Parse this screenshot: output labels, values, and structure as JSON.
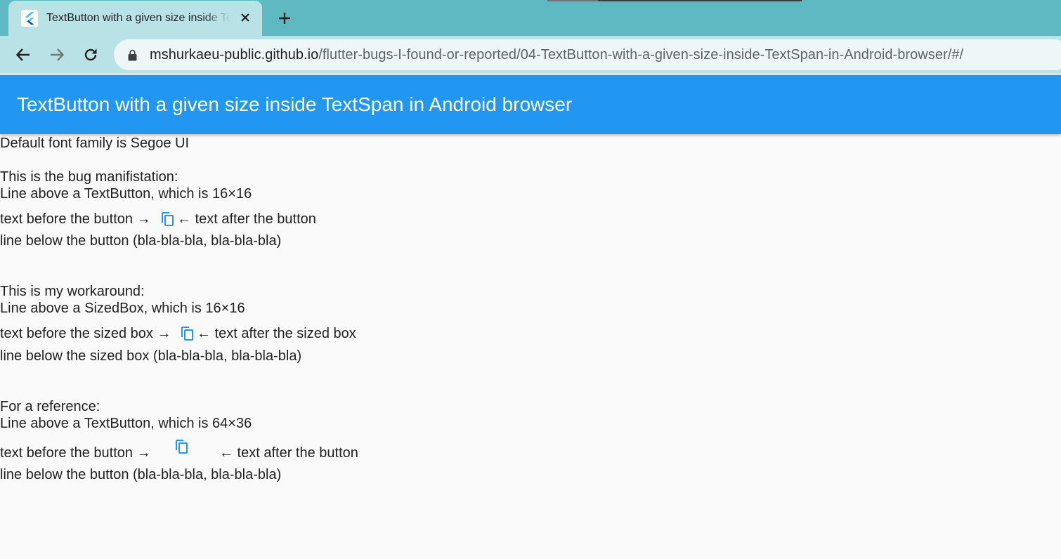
{
  "browser": {
    "tab": {
      "title": "TextButton with a given size inside TextSpan in Android browser",
      "favicon": "flutter-logo-icon",
      "close_icon": "close-icon"
    },
    "new_tab_icon": "plus-icon",
    "nav": {
      "back_icon": "arrow-left-icon",
      "forward_icon": "arrow-right-icon",
      "reload_icon": "reload-icon"
    },
    "omnibox": {
      "lock_icon": "lock-icon",
      "host": "mshurkaeu-public.github.io",
      "path": "/flutter-bugs-I-found-or-reported/04-TextButton-with-a-given-size-inside-TextSpan-in-Android-browser/#/"
    },
    "colors": {
      "tabstrip": "#5fb9c2",
      "active_tab": "#b9e2e6",
      "toolbar": "#b9e2e6"
    }
  },
  "appbar": {
    "title": "TextButton with a given size inside TextSpan in Android browser",
    "color": "#2196f3"
  },
  "content": {
    "default_font": "Default font family is Segoe UI",
    "section1": {
      "heading": "This is the bug manifistation:",
      "line_above": "Line above a TextButton, which is 16×16",
      "before": "text before the button →",
      "after": "← text after the button",
      "line_below": "line below the button (bla-bla-bla, bla-bla-bla)",
      "icon": "copy-icon"
    },
    "section2": {
      "heading": "This is my workaround:",
      "line_above": "Line above a SizedBox, which is 16×16",
      "before": "text before the sized box →",
      "after": "← text after the sized box",
      "line_below": "line below the sized box (bla-bla-bla, bla-bla-bla)",
      "icon": "copy-icon"
    },
    "section3": {
      "heading": "For a reference:",
      "line_above": "Line above a TextButton, which is 64×36",
      "before": "text before the button →",
      "after": "← text after the button",
      "line_below": "line below the button (bla-bla-bla, bla-bla-bla)",
      "icon": "copy-icon"
    },
    "icon_color": "#2196f3"
  }
}
